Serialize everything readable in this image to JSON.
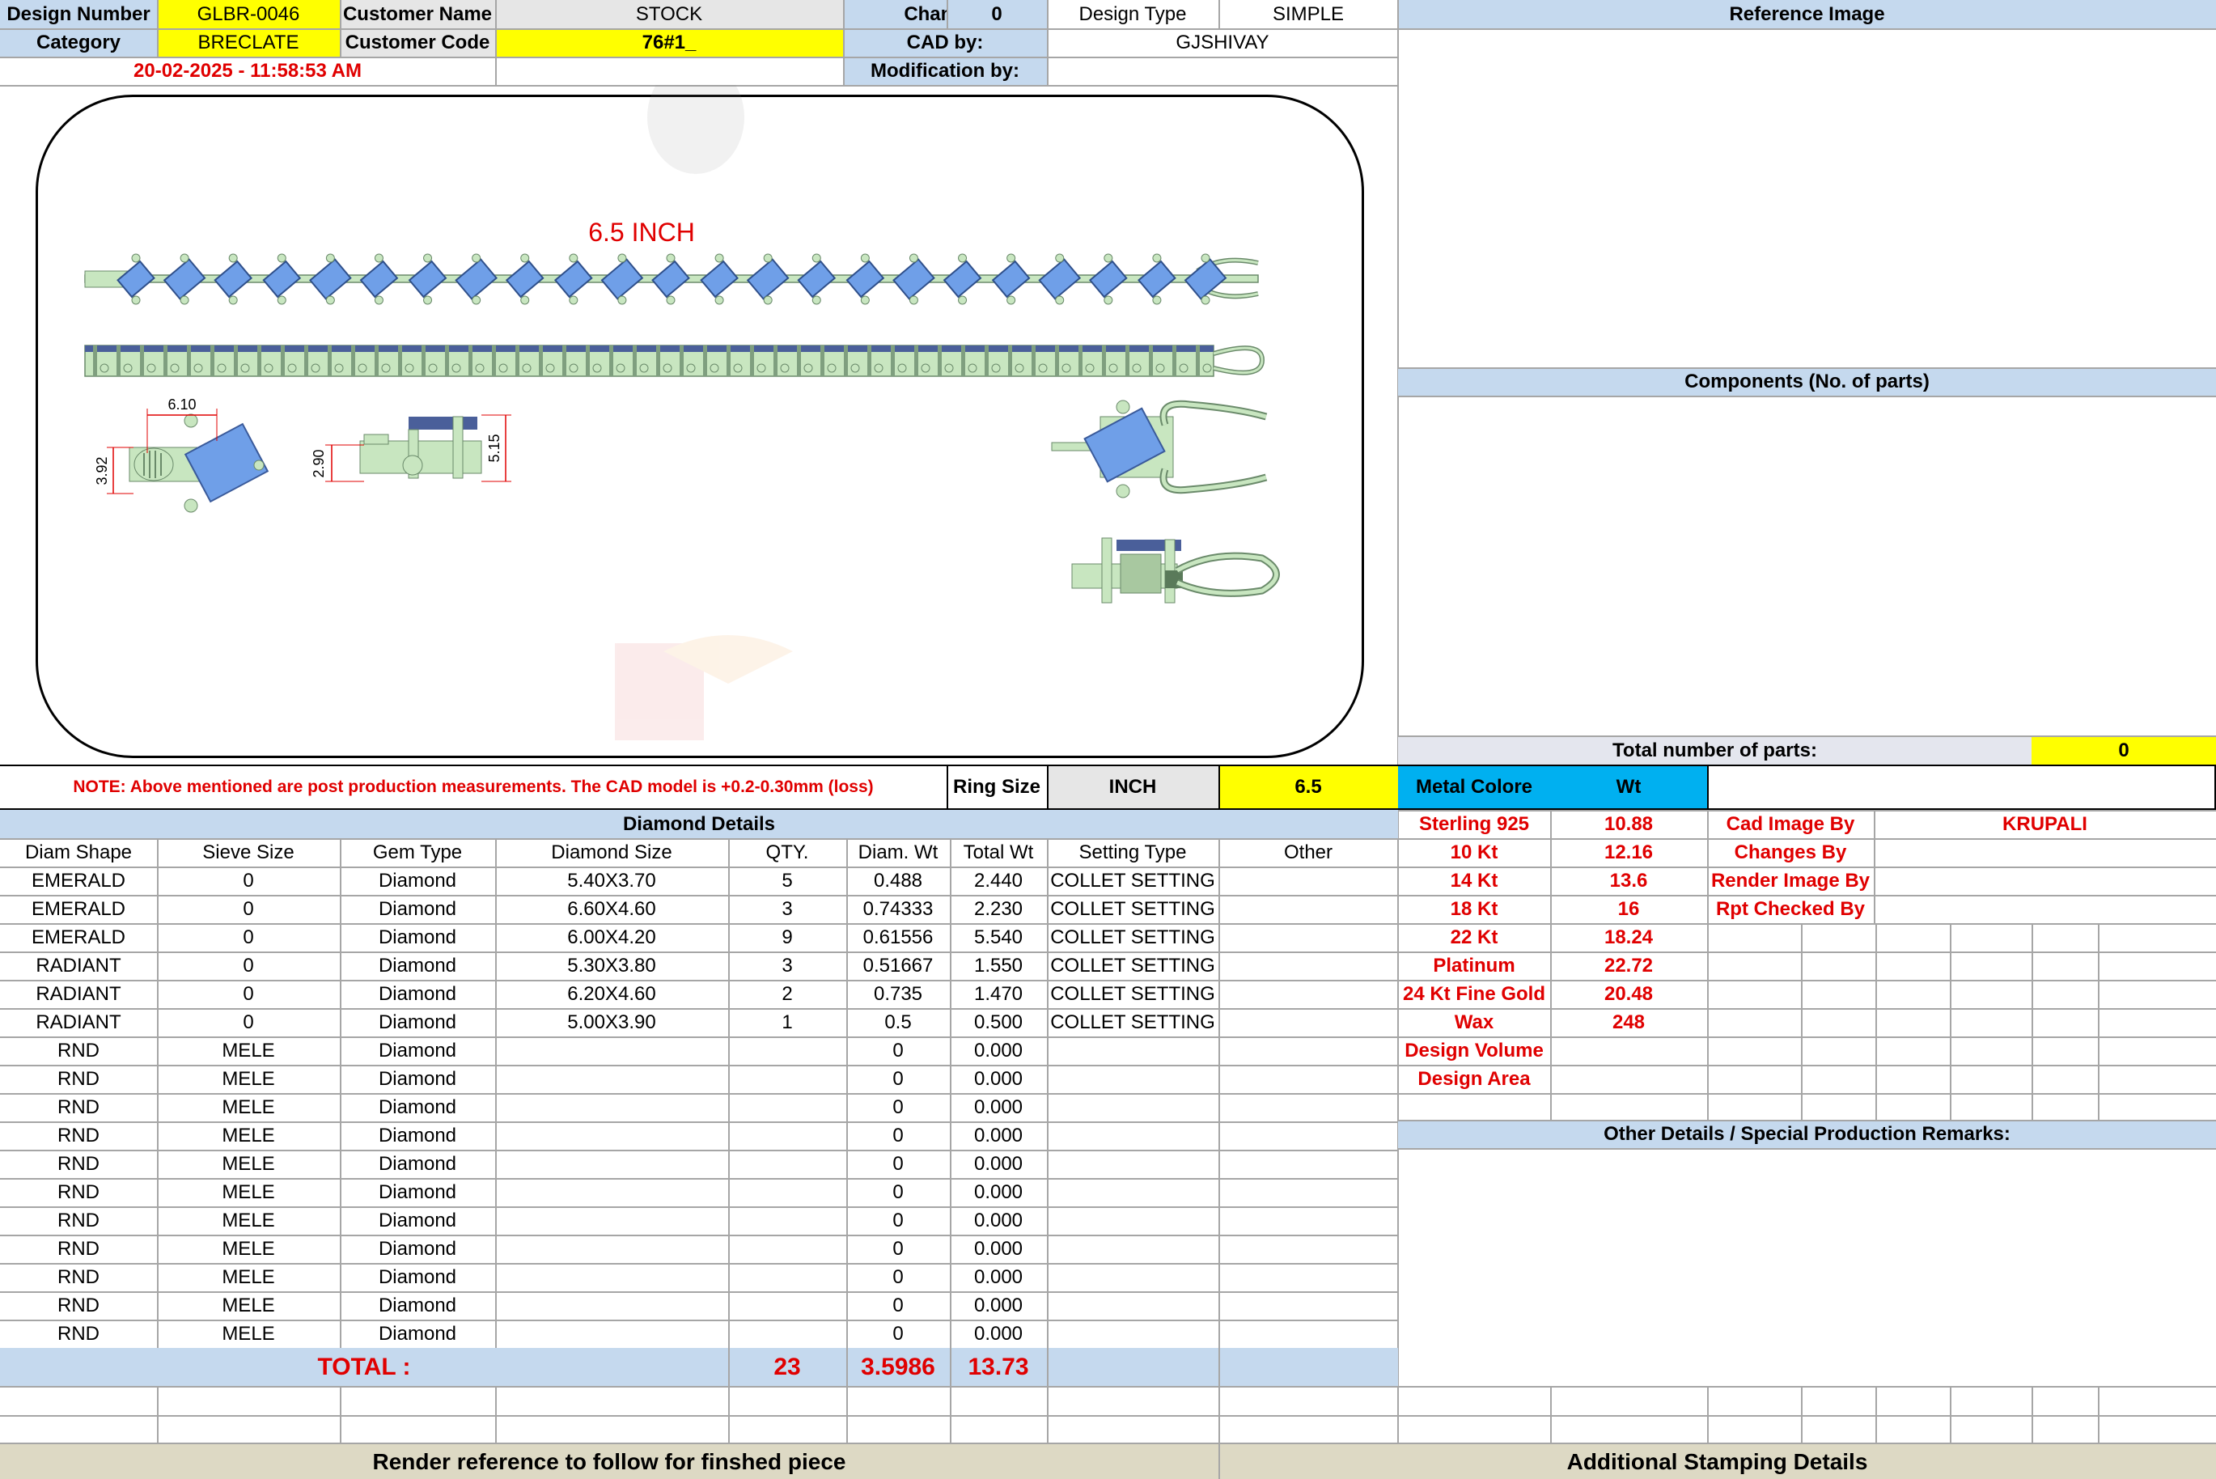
{
  "header": {
    "design_number_label": "Design Number",
    "design_number": "GLBR-0046",
    "customer_name_label": "Customer Name",
    "customer_name": "STOCK",
    "changes_label": "Changes",
    "changes": "0",
    "design_type_label": "Design Type",
    "design_type": "SIMPLE",
    "category_label": "Category",
    "category": "BRECLATE",
    "customer_code_label": "Customer Code",
    "customer_code": "76#1_",
    "cad_by_label": "CAD by:",
    "cad_by": "GJSHIVAY",
    "timestamp": "20-02-2025 - 11:58:53 AM",
    "modification_by_label": "Modification by:",
    "modification_by": ""
  },
  "reference_image_label": "Reference Image",
  "components_label": "Components (No. of parts)",
  "total_parts_label": "Total number of parts:",
  "total_parts": "0",
  "drawing": {
    "length_label": "6.5 INCH",
    "dim_width": "6.10",
    "dim_height": "3.92",
    "dim_side_a": "2.90",
    "dim_side_b": "5.15"
  },
  "note": "NOTE: Above mentioned are post production measurements. The CAD model is +0.2-0.30mm (loss)",
  "ring_size_label": "Ring Size",
  "ring_size_unit": "INCH",
  "ring_size": "6.5",
  "metal_colore_label": "Metal Colore",
  "wt_label": "Wt",
  "metals": [
    {
      "name": "Sterling 925",
      "wt": "10.88"
    },
    {
      "name": "10 Kt",
      "wt": "12.16"
    },
    {
      "name": "14 Kt",
      "wt": "13.6"
    },
    {
      "name": "18 Kt",
      "wt": "16"
    },
    {
      "name": "22 Kt",
      "wt": "18.24"
    },
    {
      "name": "Platinum",
      "wt": "22.72"
    },
    {
      "name": "24 Kt Fine Gold",
      "wt": "20.48"
    },
    {
      "name": "Wax",
      "wt": "248"
    },
    {
      "name": "Design Volume",
      "wt": ""
    },
    {
      "name": "Design Area",
      "wt": ""
    }
  ],
  "credits": [
    {
      "label": "Cad Image By",
      "value": "KRUPALI"
    },
    {
      "label": "Changes By",
      "value": ""
    },
    {
      "label": "Render Image By",
      "value": ""
    },
    {
      "label": "Rpt Checked By",
      "value": ""
    }
  ],
  "other_details_label": "Other Details / Special Production Remarks:",
  "diamond_details_label": "Diamond Details",
  "diamond_columns": [
    "Diam Shape",
    "Sieve Size",
    "Gem Type",
    "Diamond Size",
    "QTY.",
    "Diam. Wt",
    "Total Wt",
    "Setting Type",
    "Other"
  ],
  "diamond_rows": [
    [
      "EMERALD",
      "0",
      "Diamond",
      "5.40X3.70",
      "5",
      "0.488",
      "2.440",
      "COLLET SETTING",
      ""
    ],
    [
      "EMERALD",
      "0",
      "Diamond",
      "6.60X4.60",
      "3",
      "0.74333",
      "2.230",
      "COLLET SETTING",
      ""
    ],
    [
      "EMERALD",
      "0",
      "Diamond",
      "6.00X4.20",
      "9",
      "0.61556",
      "5.540",
      "COLLET SETTING",
      ""
    ],
    [
      "RADIANT",
      "0",
      "Diamond",
      "5.30X3.80",
      "3",
      "0.51667",
      "1.550",
      "COLLET SETTING",
      ""
    ],
    [
      "RADIANT",
      "0",
      "Diamond",
      "6.20X4.60",
      "2",
      "0.735",
      "1.470",
      "COLLET SETTING",
      ""
    ],
    [
      "RADIANT",
      "0",
      "Diamond",
      "5.00X3.90",
      "1",
      "0.5",
      "0.500",
      "COLLET SETTING",
      ""
    ],
    [
      "RND",
      "MELE",
      "Diamond",
      "",
      "",
      "0",
      "0.000",
      "",
      ""
    ],
    [
      "RND",
      "MELE",
      "Diamond",
      "",
      "",
      "0",
      "0.000",
      "",
      ""
    ],
    [
      "RND",
      "MELE",
      "Diamond",
      "",
      "",
      "0",
      "0.000",
      "",
      ""
    ],
    [
      "RND",
      "MELE",
      "Diamond",
      "",
      "",
      "0",
      "0.000",
      "",
      ""
    ],
    [
      "RND",
      "MELE",
      "Diamond",
      "",
      "",
      "0",
      "0.000",
      "",
      ""
    ],
    [
      "RND",
      "MELE",
      "Diamond",
      "",
      "",
      "0",
      "0.000",
      "",
      ""
    ],
    [
      "RND",
      "MELE",
      "Diamond",
      "",
      "",
      "0",
      "0.000",
      "",
      ""
    ],
    [
      "RND",
      "MELE",
      "Diamond",
      "",
      "",
      "0",
      "0.000",
      "",
      ""
    ],
    [
      "RND",
      "MELE",
      "Diamond",
      "",
      "",
      "0",
      "0.000",
      "",
      ""
    ],
    [
      "RND",
      "MELE",
      "Diamond",
      "",
      "",
      "0",
      "0.000",
      "",
      ""
    ],
    [
      "RND",
      "MELE",
      "Diamond",
      "",
      "",
      "0",
      "0.000",
      "",
      ""
    ]
  ],
  "total": {
    "label": "TOTAL :",
    "qty": "23",
    "diam_wt": "3.5986",
    "total_wt": "13.73"
  },
  "footer": {
    "render_reference": "Render reference to follow for finshed piece",
    "additional_stamping": "Additional Stamping Details"
  },
  "colors": {
    "header_blue": "#c5d9ee",
    "highlight_yellow": "#ffff00",
    "metal_cyan": "#00b0f0",
    "red_text": "#e00000",
    "metal_green": "#c8e6c0",
    "gem_blue": "#6f9fe8",
    "footer_tan": "#ddd9c4"
  }
}
